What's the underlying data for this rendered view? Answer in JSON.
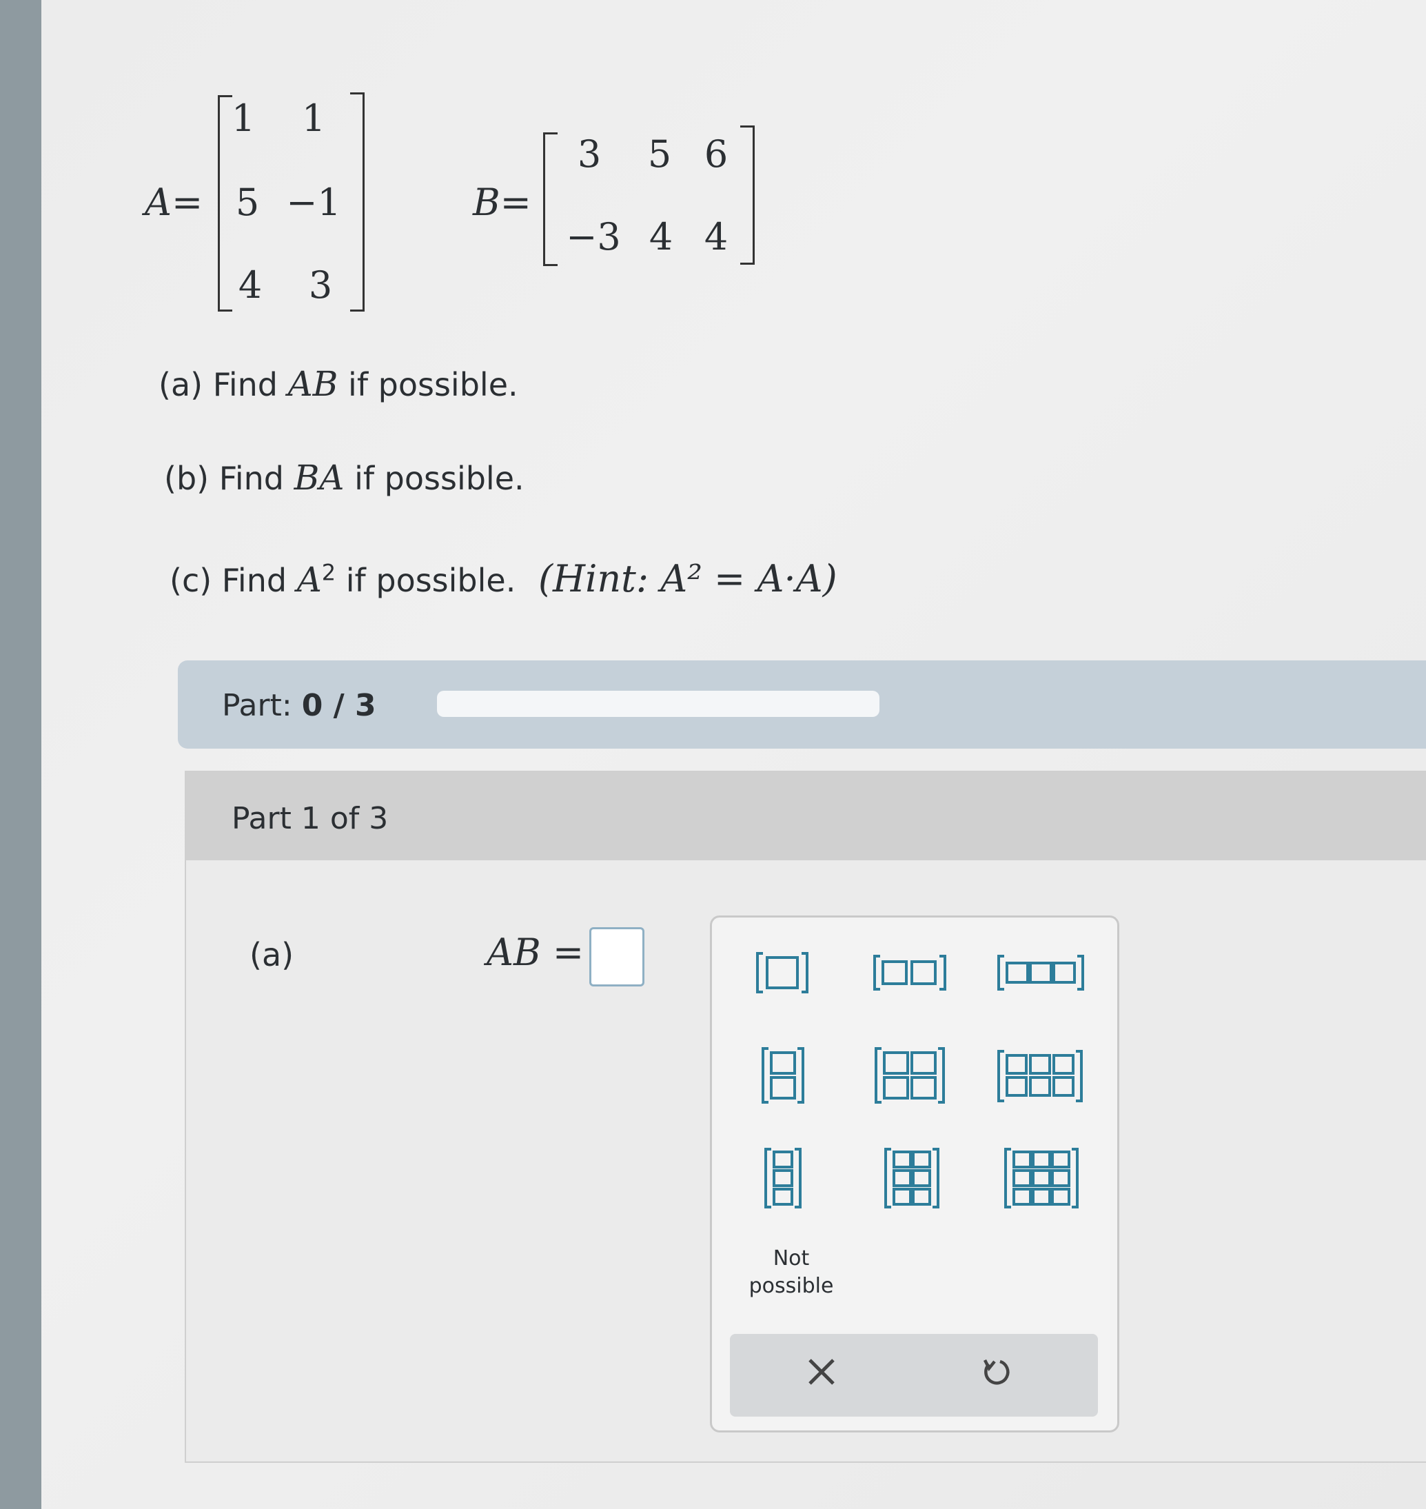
{
  "problem": {
    "matrix_a": {
      "label": "A=",
      "rows": [
        [
          "1",
          "1"
        ],
        [
          "5",
          "−1"
        ],
        [
          "4",
          "3"
        ]
      ]
    },
    "matrix_b": {
      "label": "B=",
      "rows": [
        [
          "3",
          "5",
          "6"
        ],
        [
          "−3",
          "4",
          "4"
        ]
      ]
    },
    "questions": [
      {
        "prefix": "(a) Find ",
        "math": "AB",
        "suffix": " if possible."
      },
      {
        "prefix": "(b) Find ",
        "math": "BA",
        "suffix": " if possible."
      },
      {
        "prefix": "(c) Find ",
        "math": "A",
        "sup": "2",
        "suffix": " if possible.",
        "hint": "(Hint: A² = A·A)"
      }
    ]
  },
  "progress": {
    "label": "Part:",
    "value": "0 / 3",
    "fraction": 0
  },
  "part": {
    "header": "Part 1 of 3",
    "sub_label": "(a)",
    "equation": "AB ="
  },
  "palette": {
    "templates": [
      "1x1",
      "1x2",
      "1x3",
      "2x1",
      "2x2",
      "2x3",
      "3x1",
      "3x2",
      "3x3"
    ],
    "not_possible": "Not possible",
    "clear_icon": "close-icon",
    "undo_icon": "undo-icon"
  }
}
